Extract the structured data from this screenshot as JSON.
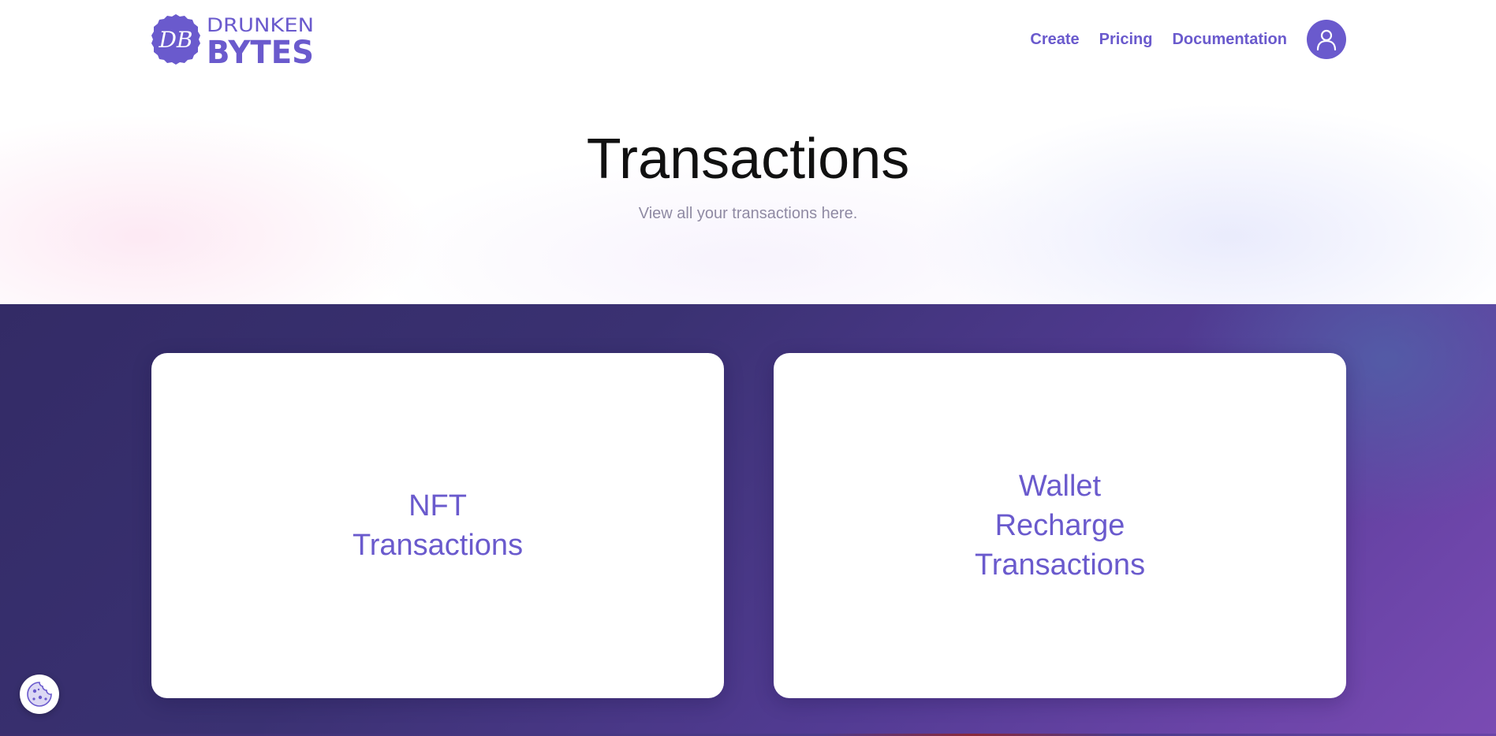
{
  "brand": {
    "logo_monogram": "DB",
    "logo_line1": "DRUNKEN",
    "logo_line2": "BYTES",
    "color": "#6a5acd"
  },
  "nav": {
    "links": [
      {
        "label": "Create"
      },
      {
        "label": "Pricing"
      },
      {
        "label": "Documentation"
      }
    ],
    "avatar_icon": "user-icon"
  },
  "hero": {
    "title": "Transactions",
    "subtitle": "View all your transactions here."
  },
  "cards": [
    {
      "label": "NFT Transactions"
    },
    {
      "label": "Wallet Recharge Transactions"
    }
  ],
  "cookie_button": {
    "icon": "cookie-icon"
  },
  "colors": {
    "accent": "#6a5acd",
    "section_bg_start": "#332b66",
    "section_bg_end": "#7a4bb3",
    "title_text": "#111111",
    "subtitle_text": "#8f8aa3"
  }
}
